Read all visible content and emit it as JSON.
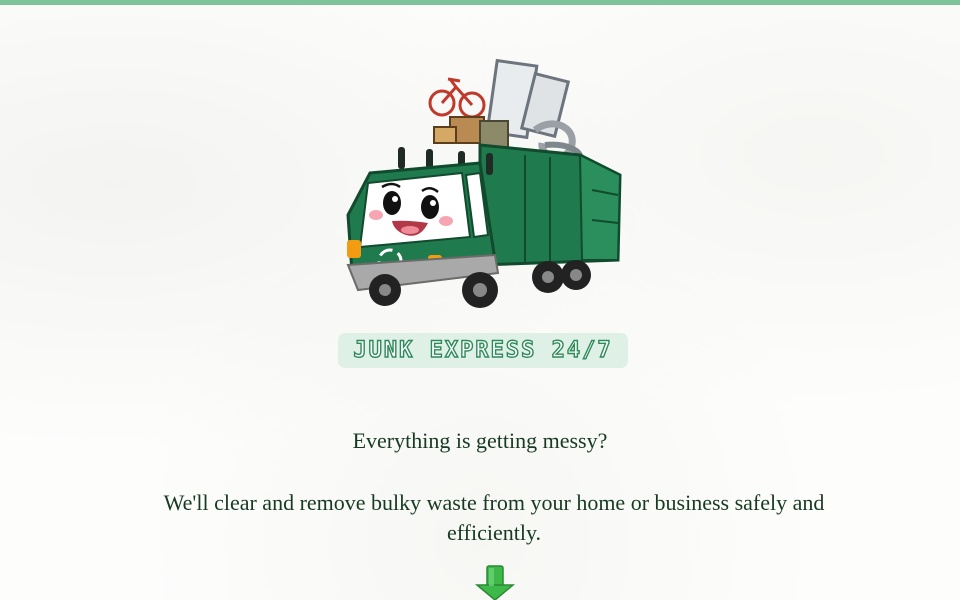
{
  "brand": {
    "name": "JUNK EXPRESS 24/7",
    "logo_icon": "junk-truck-icon",
    "accent_color": "#2f8a5a",
    "badge_color": "#dff1e6"
  },
  "hero": {
    "headline": "Everything is getting messy?",
    "tagline": "We'll clear and remove bulky waste from your home or business safely and efficiently.",
    "scroll_icon": "arrow-down-icon"
  },
  "colors": {
    "top_bar": "#7fc39a",
    "text": "#173a22",
    "arrow": "#3fb84a"
  }
}
